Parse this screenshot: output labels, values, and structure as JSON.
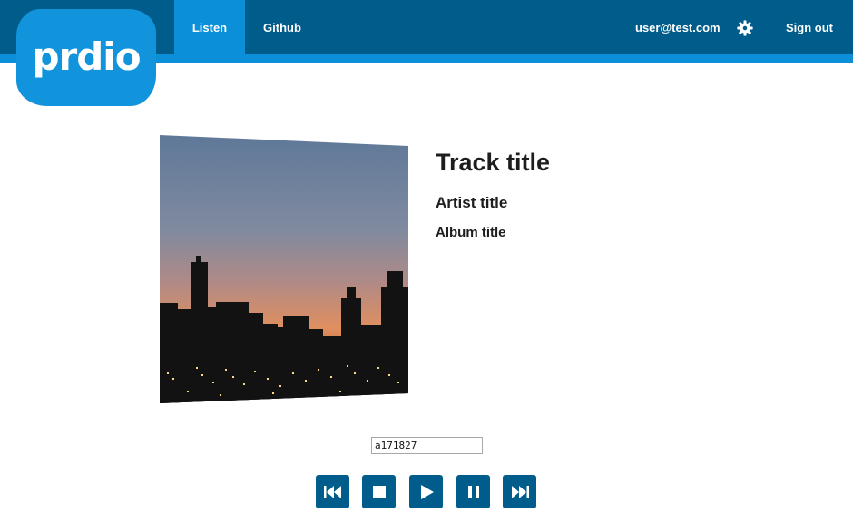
{
  "brand": {
    "logo_text": "prdio"
  },
  "nav": {
    "items": [
      {
        "label": "Listen",
        "active": true
      },
      {
        "label": "Github",
        "active": false
      }
    ]
  },
  "account": {
    "email": "user@test.com",
    "signout_label": "Sign out",
    "settings_icon": "gear-icon"
  },
  "track": {
    "title": "Track title",
    "artist": "Artist title",
    "album": "Album title"
  },
  "player": {
    "track_id_value": "a171827",
    "controls": [
      "previous-icon",
      "stop-icon",
      "play-icon",
      "pause-icon",
      "next-icon"
    ]
  },
  "colors": {
    "header": "#005c8a",
    "accent": "#0a8fd8",
    "logo": "#1294dd",
    "button": "#005c8a"
  }
}
